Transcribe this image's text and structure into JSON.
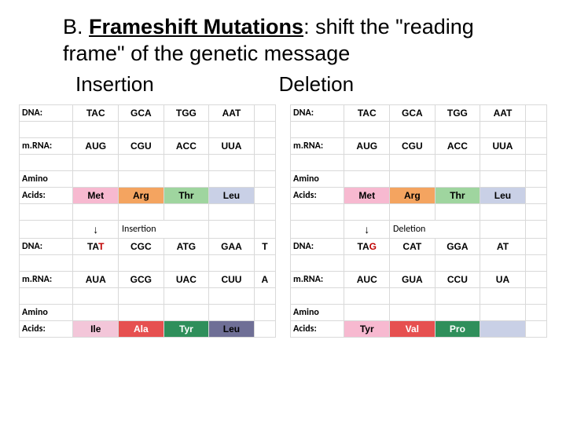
{
  "title": {
    "label": "B.",
    "term": "Frameshift Mutations",
    "rest": ": shift the \"reading frame\" of the genetic message"
  },
  "subs": {
    "ins": "Insertion",
    "del": "Deletion"
  },
  "labels": {
    "dna": "DNA:",
    "mrna": "m.RNA:",
    "amino": "Amino",
    "acids": "Acids:",
    "arrow": "↓",
    "insertion": "Insertion",
    "deletion": "Deletion"
  },
  "ins": {
    "dna1": [
      "TAC",
      "GCA",
      "TGG",
      "AAT"
    ],
    "mrna1": [
      "AUG",
      "CGU",
      "ACC",
      "UUA"
    ],
    "aa1": [
      "Met",
      "Arg",
      "Thr",
      "Leu"
    ],
    "dna2_pre": "TA",
    "dna2_mut": "T",
    "dna2": [
      "CGC",
      "ATG",
      "GAA",
      "T"
    ],
    "mrna2": [
      "AUA",
      "GCG",
      "UAC",
      "CUU",
      "A"
    ],
    "aa2": [
      "Ile",
      "Ala",
      "Tyr",
      "Leu"
    ]
  },
  "del": {
    "dna1": [
      "TAC",
      "GCA",
      "TGG",
      "AAT"
    ],
    "mrna1": [
      "AUG",
      "CGU",
      "ACC",
      "UUA"
    ],
    "aa1": [
      "Met",
      "Arg",
      "Thr",
      "Leu"
    ],
    "dna2_pre": "TA",
    "dna2_mut": "G",
    "dna2": [
      "CAT",
      "GGA",
      "AT"
    ],
    "mrna2": [
      "AUC",
      "GUA",
      "CCU",
      "UA"
    ],
    "aa2": [
      "Tyr",
      "Val",
      "Pro",
      ""
    ]
  }
}
